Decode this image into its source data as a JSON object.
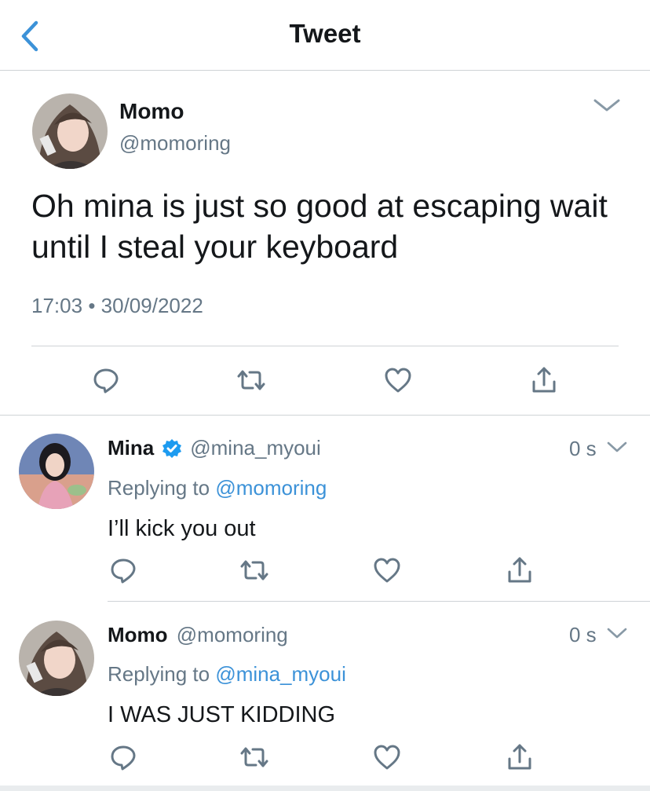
{
  "header": {
    "title": "Tweet",
    "back_icon": "chevron-left-icon"
  },
  "main_tweet": {
    "name": "Momo",
    "handle": "@momoring",
    "text": "Oh mina is just so good at escaping wait until I steal your keyboard",
    "time": "17:03",
    "separator": "•",
    "date": "30/09/2022",
    "actions": [
      "reply-icon",
      "retweet-icon",
      "like-icon",
      "share-icon"
    ]
  },
  "replies": [
    {
      "name": "Mina",
      "verified": true,
      "handle": "@mina_myoui",
      "age": "0 s",
      "replying_prefix": "Replying to",
      "replying_to": "@momoring",
      "text": "I’ll kick you out"
    },
    {
      "name": "Momo",
      "verified": false,
      "handle": "@momoring",
      "age": "0 s",
      "replying_prefix": "Replying to",
      "replying_to": "@mina_myoui",
      "text": "I WAS JUST KIDDING"
    }
  ],
  "colors": {
    "accent": "#3c92d8",
    "verified": "#1d9bf0",
    "muted": "#657786",
    "divider": "#cfd3d6"
  }
}
